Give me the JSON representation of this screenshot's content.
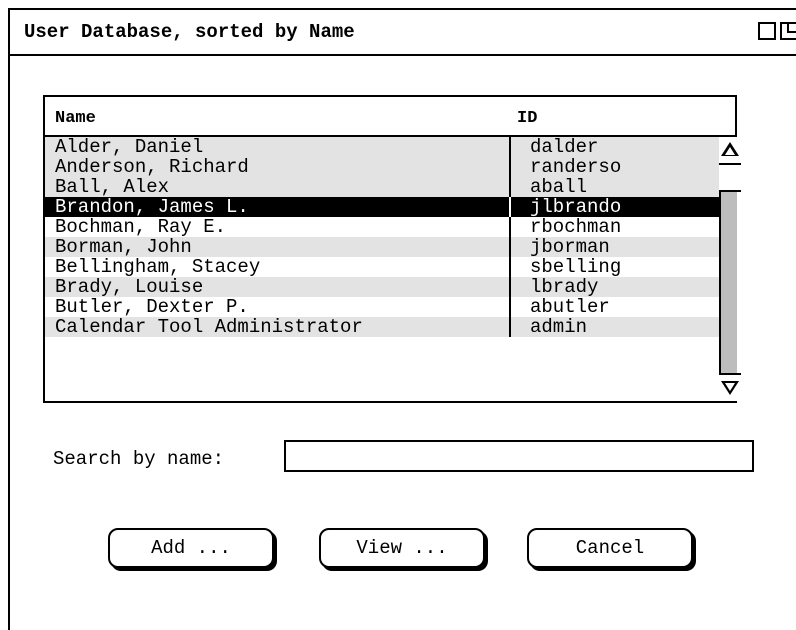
{
  "window": {
    "title": "User Database, sorted by Name"
  },
  "table": {
    "columns": [
      "Name",
      "ID"
    ],
    "rows": [
      {
        "name": "Alder, Daniel",
        "id": "dalder"
      },
      {
        "name": "Anderson, Richard",
        "id": "randerso"
      },
      {
        "name": "Ball, Alex",
        "id": "aball"
      },
      {
        "name": "Brandon, James L.",
        "id": "jlbrando",
        "selected": true
      },
      {
        "name": "Bochman, Ray E.",
        "id": "rbochman"
      },
      {
        "name": "Borman, John",
        "id": "jborman"
      },
      {
        "name": "Bellingham, Stacey",
        "id": "sbelling"
      },
      {
        "name": "Brady, Louise",
        "id": "lbrady"
      },
      {
        "name": "Butler, Dexter P.",
        "id": "abutler"
      },
      {
        "name": "Calendar Tool Administrator",
        "id": "admin"
      }
    ]
  },
  "search": {
    "label": "Search by name:",
    "value": ""
  },
  "buttons": {
    "add": "Add ...",
    "view": "View ...",
    "cancel": "Cancel"
  }
}
